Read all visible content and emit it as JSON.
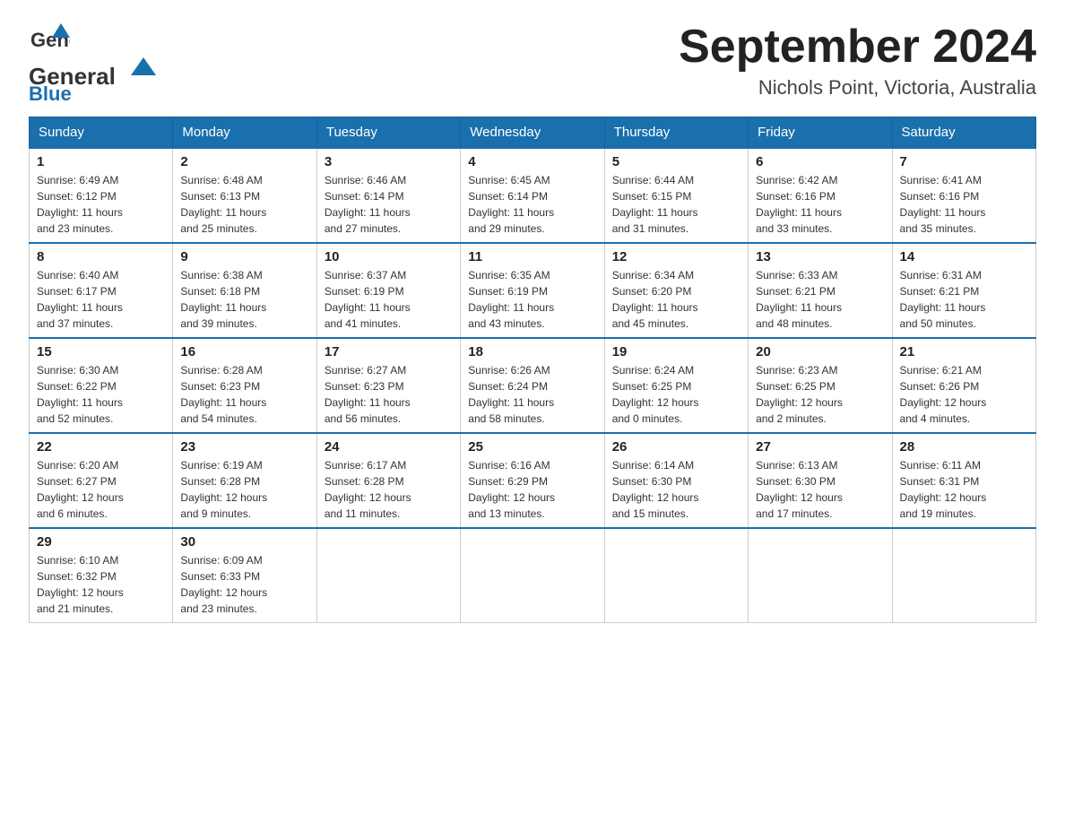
{
  "header": {
    "logo_text_general": "General",
    "logo_text_blue": "Blue",
    "main_title": "September 2024",
    "subtitle": "Nichols Point, Victoria, Australia"
  },
  "calendar": {
    "days_of_week": [
      "Sunday",
      "Monday",
      "Tuesday",
      "Wednesday",
      "Thursday",
      "Friday",
      "Saturday"
    ],
    "weeks": [
      [
        {
          "day": "1",
          "sunrise": "6:49 AM",
          "sunset": "6:12 PM",
          "daylight": "11 hours and 23 minutes."
        },
        {
          "day": "2",
          "sunrise": "6:48 AM",
          "sunset": "6:13 PM",
          "daylight": "11 hours and 25 minutes."
        },
        {
          "day": "3",
          "sunrise": "6:46 AM",
          "sunset": "6:14 PM",
          "daylight": "11 hours and 27 minutes."
        },
        {
          "day": "4",
          "sunrise": "6:45 AM",
          "sunset": "6:14 PM",
          "daylight": "11 hours and 29 minutes."
        },
        {
          "day": "5",
          "sunrise": "6:44 AM",
          "sunset": "6:15 PM",
          "daylight": "11 hours and 31 minutes."
        },
        {
          "day": "6",
          "sunrise": "6:42 AM",
          "sunset": "6:16 PM",
          "daylight": "11 hours and 33 minutes."
        },
        {
          "day": "7",
          "sunrise": "6:41 AM",
          "sunset": "6:16 PM",
          "daylight": "11 hours and 35 minutes."
        }
      ],
      [
        {
          "day": "8",
          "sunrise": "6:40 AM",
          "sunset": "6:17 PM",
          "daylight": "11 hours and 37 minutes."
        },
        {
          "day": "9",
          "sunrise": "6:38 AM",
          "sunset": "6:18 PM",
          "daylight": "11 hours and 39 minutes."
        },
        {
          "day": "10",
          "sunrise": "6:37 AM",
          "sunset": "6:19 PM",
          "daylight": "11 hours and 41 minutes."
        },
        {
          "day": "11",
          "sunrise": "6:35 AM",
          "sunset": "6:19 PM",
          "daylight": "11 hours and 43 minutes."
        },
        {
          "day": "12",
          "sunrise": "6:34 AM",
          "sunset": "6:20 PM",
          "daylight": "11 hours and 45 minutes."
        },
        {
          "day": "13",
          "sunrise": "6:33 AM",
          "sunset": "6:21 PM",
          "daylight": "11 hours and 48 minutes."
        },
        {
          "day": "14",
          "sunrise": "6:31 AM",
          "sunset": "6:21 PM",
          "daylight": "11 hours and 50 minutes."
        }
      ],
      [
        {
          "day": "15",
          "sunrise": "6:30 AM",
          "sunset": "6:22 PM",
          "daylight": "11 hours and 52 minutes."
        },
        {
          "day": "16",
          "sunrise": "6:28 AM",
          "sunset": "6:23 PM",
          "daylight": "11 hours and 54 minutes."
        },
        {
          "day": "17",
          "sunrise": "6:27 AM",
          "sunset": "6:23 PM",
          "daylight": "11 hours and 56 minutes."
        },
        {
          "day": "18",
          "sunrise": "6:26 AM",
          "sunset": "6:24 PM",
          "daylight": "11 hours and 58 minutes."
        },
        {
          "day": "19",
          "sunrise": "6:24 AM",
          "sunset": "6:25 PM",
          "daylight": "12 hours and 0 minutes."
        },
        {
          "day": "20",
          "sunrise": "6:23 AM",
          "sunset": "6:25 PM",
          "daylight": "12 hours and 2 minutes."
        },
        {
          "day": "21",
          "sunrise": "6:21 AM",
          "sunset": "6:26 PM",
          "daylight": "12 hours and 4 minutes."
        }
      ],
      [
        {
          "day": "22",
          "sunrise": "6:20 AM",
          "sunset": "6:27 PM",
          "daylight": "12 hours and 6 minutes."
        },
        {
          "day": "23",
          "sunrise": "6:19 AM",
          "sunset": "6:28 PM",
          "daylight": "12 hours and 9 minutes."
        },
        {
          "day": "24",
          "sunrise": "6:17 AM",
          "sunset": "6:28 PM",
          "daylight": "12 hours and 11 minutes."
        },
        {
          "day": "25",
          "sunrise": "6:16 AM",
          "sunset": "6:29 PM",
          "daylight": "12 hours and 13 minutes."
        },
        {
          "day": "26",
          "sunrise": "6:14 AM",
          "sunset": "6:30 PM",
          "daylight": "12 hours and 15 minutes."
        },
        {
          "day": "27",
          "sunrise": "6:13 AM",
          "sunset": "6:30 PM",
          "daylight": "12 hours and 17 minutes."
        },
        {
          "day": "28",
          "sunrise": "6:11 AM",
          "sunset": "6:31 PM",
          "daylight": "12 hours and 19 minutes."
        }
      ],
      [
        {
          "day": "29",
          "sunrise": "6:10 AM",
          "sunset": "6:32 PM",
          "daylight": "12 hours and 21 minutes."
        },
        {
          "day": "30",
          "sunrise": "6:09 AM",
          "sunset": "6:33 PM",
          "daylight": "12 hours and 23 minutes."
        },
        null,
        null,
        null,
        null,
        null
      ]
    ],
    "labels": {
      "sunrise": "Sunrise:",
      "sunset": "Sunset:",
      "daylight": "Daylight:"
    }
  }
}
